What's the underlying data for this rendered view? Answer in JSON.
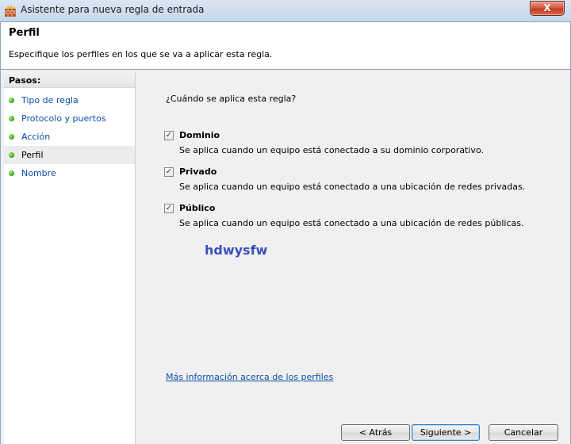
{
  "window": {
    "title": "Asistente para nueva regla de entrada",
    "close_label": "X"
  },
  "header": {
    "title": "Perfil",
    "description": "Especifique los perfiles en los que se va a aplicar esta regla."
  },
  "sidebar": {
    "heading": "Pasos:",
    "steps": [
      {
        "label": "Tipo de regla",
        "current": false
      },
      {
        "label": "Protocolo y puertos",
        "current": false
      },
      {
        "label": "Acción",
        "current": false
      },
      {
        "label": "Perfil",
        "current": true
      },
      {
        "label": "Nombre",
        "current": false
      }
    ]
  },
  "main": {
    "question": "¿Cuándo se aplica esta regla?",
    "options": [
      {
        "title": "Dominio",
        "checked": true,
        "description": "Se aplica cuando un equipo está conectado a su dominio corporativo."
      },
      {
        "title": "Privado",
        "checked": true,
        "description": "Se aplica cuando un equipo está conectado a una ubicación de redes privadas."
      },
      {
        "title": "Público",
        "checked": true,
        "description": "Se aplica cuando un equipo está conectado a una ubicación de redes públicas."
      }
    ],
    "watermark": "hdwysfw",
    "more_info_link": "Más información acerca de los perfiles",
    "check_mark": "✓"
  },
  "buttons": {
    "back": "< Atrás",
    "next": "Siguiente >",
    "cancel": "Cancelar"
  }
}
